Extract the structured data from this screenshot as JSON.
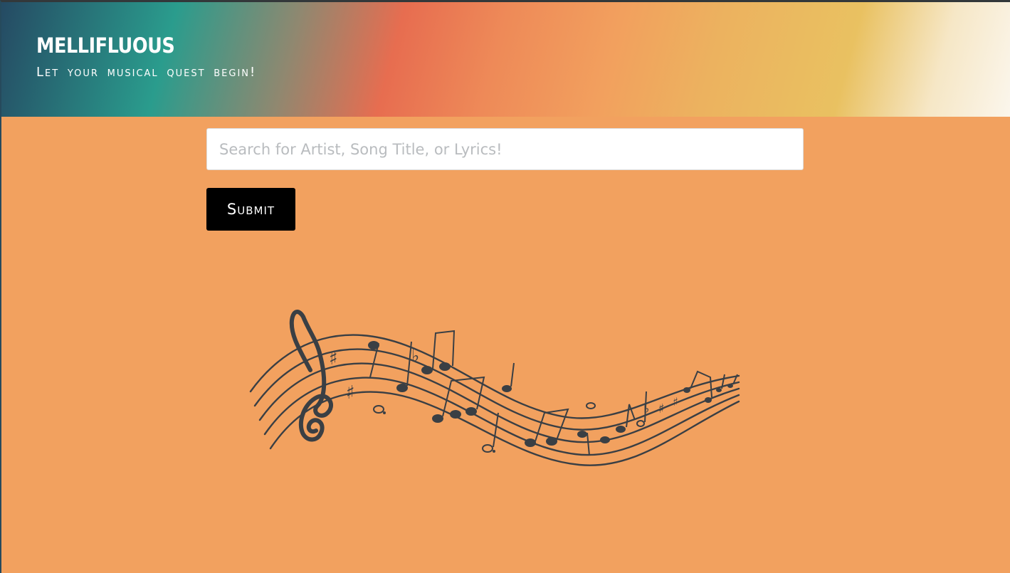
{
  "header": {
    "title": "MELLIFLUOUS",
    "tagline": "Let your musical quest begin!"
  },
  "search": {
    "placeholder": "Search for Artist, Song Title, or Lyrics!",
    "value": ""
  },
  "form": {
    "submit_label": "Submit"
  },
  "colors": {
    "page_background": "#f2a15f",
    "button_background": "#000000",
    "music_ink": "#3a3f44"
  },
  "icons": {
    "decoration": "music-staff-notes-icon"
  }
}
